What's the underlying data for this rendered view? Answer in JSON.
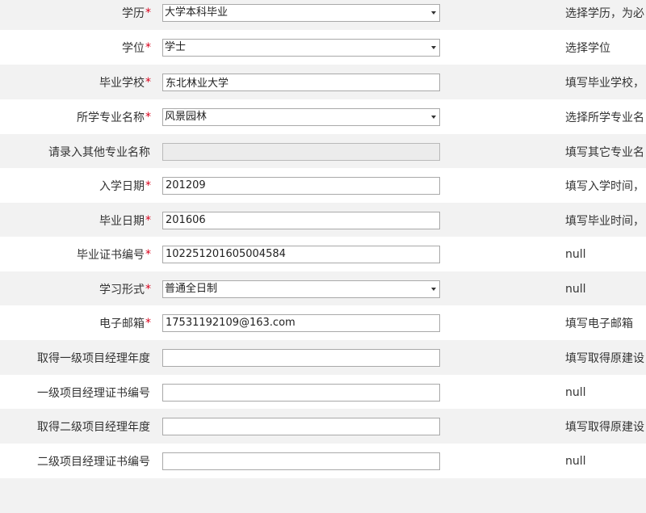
{
  "form": {
    "rows": [
      {
        "label": "学历",
        "required": "*",
        "value": "大学本科毕业",
        "hint": "选择学历，为必"
      },
      {
        "label": "学位",
        "required": "*",
        "value": "学士",
        "hint": "选择学位"
      },
      {
        "label": "毕业学校",
        "required": "*",
        "value": "东北林业大学",
        "hint": "填写毕业学校，"
      },
      {
        "label": "所学专业名称",
        "required": "*",
        "value": "风景园林",
        "hint": "选择所学专业名"
      },
      {
        "label": "请录入其他专业名称",
        "required": "",
        "value": "",
        "hint": "填写其它专业名"
      },
      {
        "label": "入学日期",
        "required": "*",
        "value": "201209",
        "hint": "填写入学时间，"
      },
      {
        "label": "毕业日期",
        "required": "*",
        "value": "201606",
        "hint": "填写毕业时间，"
      },
      {
        "label": "毕业证书编号",
        "required": "*",
        "value": "102251201605004584",
        "hint": "null"
      },
      {
        "label": "学习形式",
        "required": "*",
        "value": "普通全日制",
        "hint": "null"
      },
      {
        "label": "电子邮箱",
        "required": "*",
        "value": "17531192109@163.com",
        "hint": "填写电子邮箱"
      },
      {
        "label": "取得一级项目经理年度",
        "required": "",
        "value": "",
        "hint": "填写取得原建设"
      },
      {
        "label": "一级项目经理证书编号",
        "required": "",
        "value": "",
        "hint": "null"
      },
      {
        "label": "取得二级项目经理年度",
        "required": "",
        "value": "",
        "hint": "填写取得原建设"
      },
      {
        "label": "二级项目经理证书编号",
        "required": "",
        "value": "",
        "hint": "null"
      }
    ]
  },
  "colors": {
    "required": "#d9001b",
    "row_alt_bg": "#f2f2f2",
    "row_bg": "#ffffff",
    "field_border": "#a9a9a9",
    "disabled_bg": "#ececec"
  }
}
